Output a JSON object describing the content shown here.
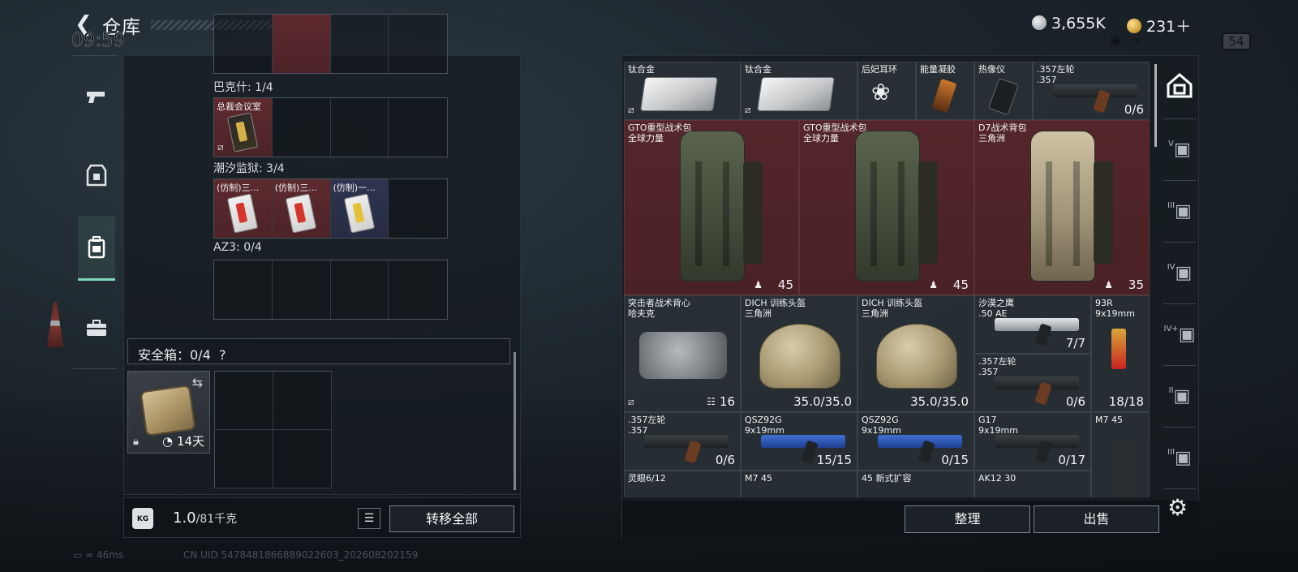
{
  "header": {
    "title": "仓库",
    "clock": "09:59",
    "battery": "54"
  },
  "currency": [
    {
      "icon": "silver-coin-icon",
      "value": "3,655K",
      "color": "#c9ced2"
    },
    {
      "icon": "gold-coin-icon",
      "value": "231＋",
      "color": "#d9a63a"
    }
  ],
  "left_nav": [
    {
      "icon": "pistol-icon",
      "active": false
    },
    {
      "icon": "armor-icon",
      "active": false
    },
    {
      "icon": "backpack-icon",
      "active": true
    },
    {
      "icon": "case-icon",
      "active": false
    }
  ],
  "pockets": [
    {
      "label": "巴克什: 1/4",
      "cells": [
        {
          "label": "总裁会议室",
          "color": "red",
          "card": "gold"
        },
        {},
        {},
        {}
      ]
    },
    {
      "label": "潮汐监狱: 3/4",
      "cells": [
        {
          "label": "(仿制)三...",
          "color": "red",
          "card": "red"
        },
        {
          "label": "(仿制)三...",
          "color": "red",
          "card": "red"
        },
        {
          "label": "(仿制)一...",
          "color": "blue",
          "card": "yellow"
        },
        {}
      ]
    },
    {
      "label": "AZ3: 0/4",
      "cells": [
        {},
        {},
        {},
        {}
      ]
    }
  ],
  "safe": {
    "label": "安全箱：0/4",
    "help": "?",
    "days": "14天"
  },
  "footer_left": {
    "weight": "1.0",
    "weight_max": "/81千克",
    "transfer_all": "转移全部",
    "kg_icon_text": "KG"
  },
  "warehouse_items": [
    {
      "name": "钛合金",
      "sub": "",
      "qty": "",
      "kind": "ingot",
      "red": false,
      "noicon": true
    },
    {
      "name": "钛合金",
      "sub": "",
      "qty": "",
      "kind": "ingot",
      "red": false,
      "noicon": true
    },
    {
      "name": "后妃耳环",
      "sub": "",
      "qty": "",
      "kind": "earring",
      "red": false
    },
    {
      "name": "能量凝胶",
      "sub": "",
      "qty": "",
      "kind": "gel",
      "red": false
    },
    {
      "name": "热像仪",
      "sub": "",
      "qty": "",
      "kind": "thermal",
      "red": false
    },
    {
      "name": ".357左轮",
      "sub": ".357",
      "qty": "0/6",
      "kind": "revolver",
      "red": false
    },
    {
      "name": "GTO重型战术包",
      "sub": "全球力量",
      "qty": "45",
      "kind": "pack",
      "red": true
    },
    {
      "name": "GTO重型战术包",
      "sub": "全球力量",
      "qty": "45",
      "kind": "pack",
      "red": true
    },
    {
      "name": "D7战术背包",
      "sub": "三角洲",
      "qty": "35",
      "kind": "pack-tan",
      "red": true
    },
    {
      "name": "突击者战术背心",
      "sub": "哈夫克",
      "qty": "16",
      "kind": "vest",
      "red": false,
      "noicon": true
    },
    {
      "name": "DICH 训练头盔",
      "sub": "三角洲",
      "qty": "35.0/35.0",
      "kind": "helmet",
      "red": false
    },
    {
      "name": "DICH 训练头盔",
      "sub": "三角洲",
      "qty": "35.0/35.0",
      "kind": "helmet",
      "red": false
    },
    {
      "name": "沙漠之鹰",
      "sub": ".50 AE",
      "qty": "7/7",
      "kind": "deagle",
      "red": false
    },
    {
      "name": "93R",
      "sub": "9x19mm",
      "qty": "18/18",
      "kind": "93r",
      "red": false
    },
    {
      "name": ".357左轮",
      "sub": ".357",
      "qty": "0/6",
      "kind": "revolver",
      "red": false
    },
    {
      "name": ".357左轮",
      "sub": ".357",
      "qty": "0/6",
      "kind": "revolver",
      "red": false
    },
    {
      "name": "QSZ92G",
      "sub": "9x19mm",
      "qty": "15/15",
      "kind": "qsz",
      "red": false
    },
    {
      "name": "QSZ92G",
      "sub": "9x19mm",
      "qty": "0/15",
      "kind": "qsz",
      "red": false
    },
    {
      "name": "G17",
      "sub": "9x19mm",
      "qty": "0/17",
      "kind": "g17",
      "red": false
    },
    {
      "name": "M7 45",
      "sub": "",
      "qty": "",
      "kind": "mag",
      "red": false
    },
    {
      "name": "灵眼6/12",
      "sub": "",
      "qty": "",
      "kind": "scope",
      "red": false
    },
    {
      "name": "M7 45",
      "sub": "",
      "qty": "",
      "kind": "mag",
      "red": false
    },
    {
      "name": "45 新式扩容",
      "sub": "",
      "qty": "",
      "kind": "mag",
      "red": false
    },
    {
      "name": "AK12 30",
      "sub": "",
      "qty": "",
      "kind": "mag",
      "red": false
    }
  ],
  "footer_right": {
    "sort": "整理",
    "sell": "出售"
  },
  "right_nav": [
    {
      "icon": "home-vault-icon",
      "label": "",
      "active": true
    },
    {
      "icon": "vault-v-icon",
      "label": "V",
      "active": false
    },
    {
      "icon": "vault-iii-icon",
      "label": "III",
      "active": false
    },
    {
      "icon": "vault-iv-icon",
      "label": "IV",
      "active": false
    },
    {
      "icon": "vault-iv-add-icon",
      "label": "IV+",
      "active": false
    },
    {
      "icon": "vault-ii-icon",
      "label": "II",
      "active": false
    },
    {
      "icon": "vault-iii-b-icon",
      "label": "III",
      "active": false
    }
  ],
  "status_bar": {
    "ping": "46ms",
    "uid": "CN UID 5478481866889022603_202608202159"
  }
}
